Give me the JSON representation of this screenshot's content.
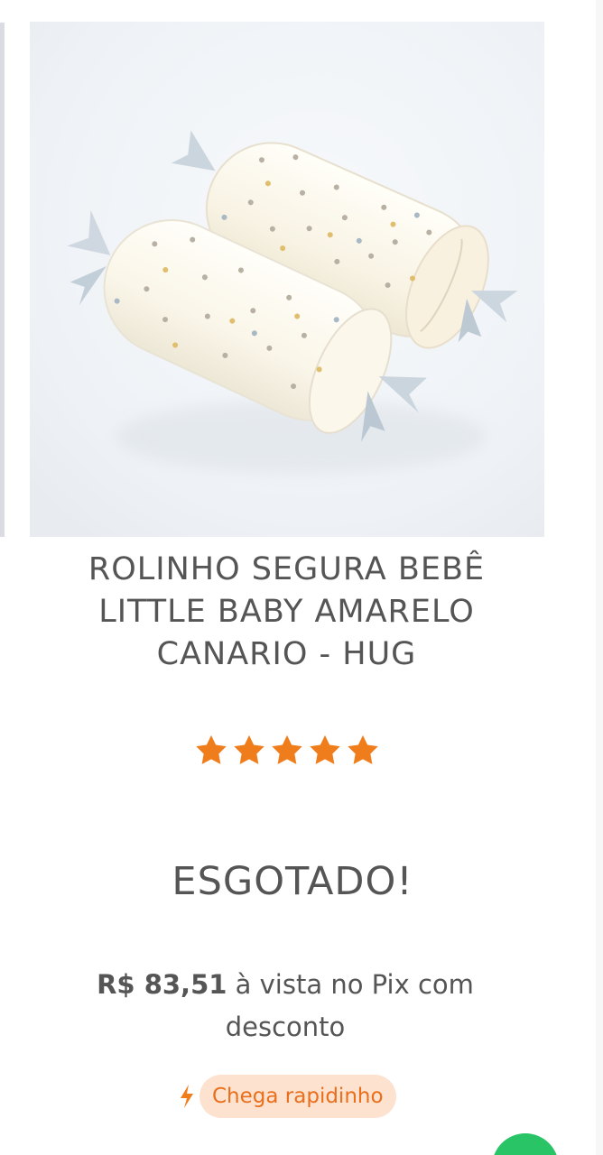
{
  "product": {
    "image_name": "rolinho segura bebe product photo",
    "title": "ROLINHO SEGURA BEBÊ LITTLE BABY AMARELO CANARIO - HUG",
    "rating": 5,
    "stock_status": "ESGOTADO!",
    "price": {
      "value": "R$ 83,51",
      "suffix": " à vista no Pix com desconto"
    },
    "delivery": {
      "icon": "lightning-icon",
      "label": "Chega rapidinho"
    }
  },
  "colors": {
    "star": "#f07d1b",
    "delivery_background": "#fde2d0",
    "delivery_text": "#e96f1c",
    "text": "#555555",
    "floating_button": "#28c466"
  }
}
